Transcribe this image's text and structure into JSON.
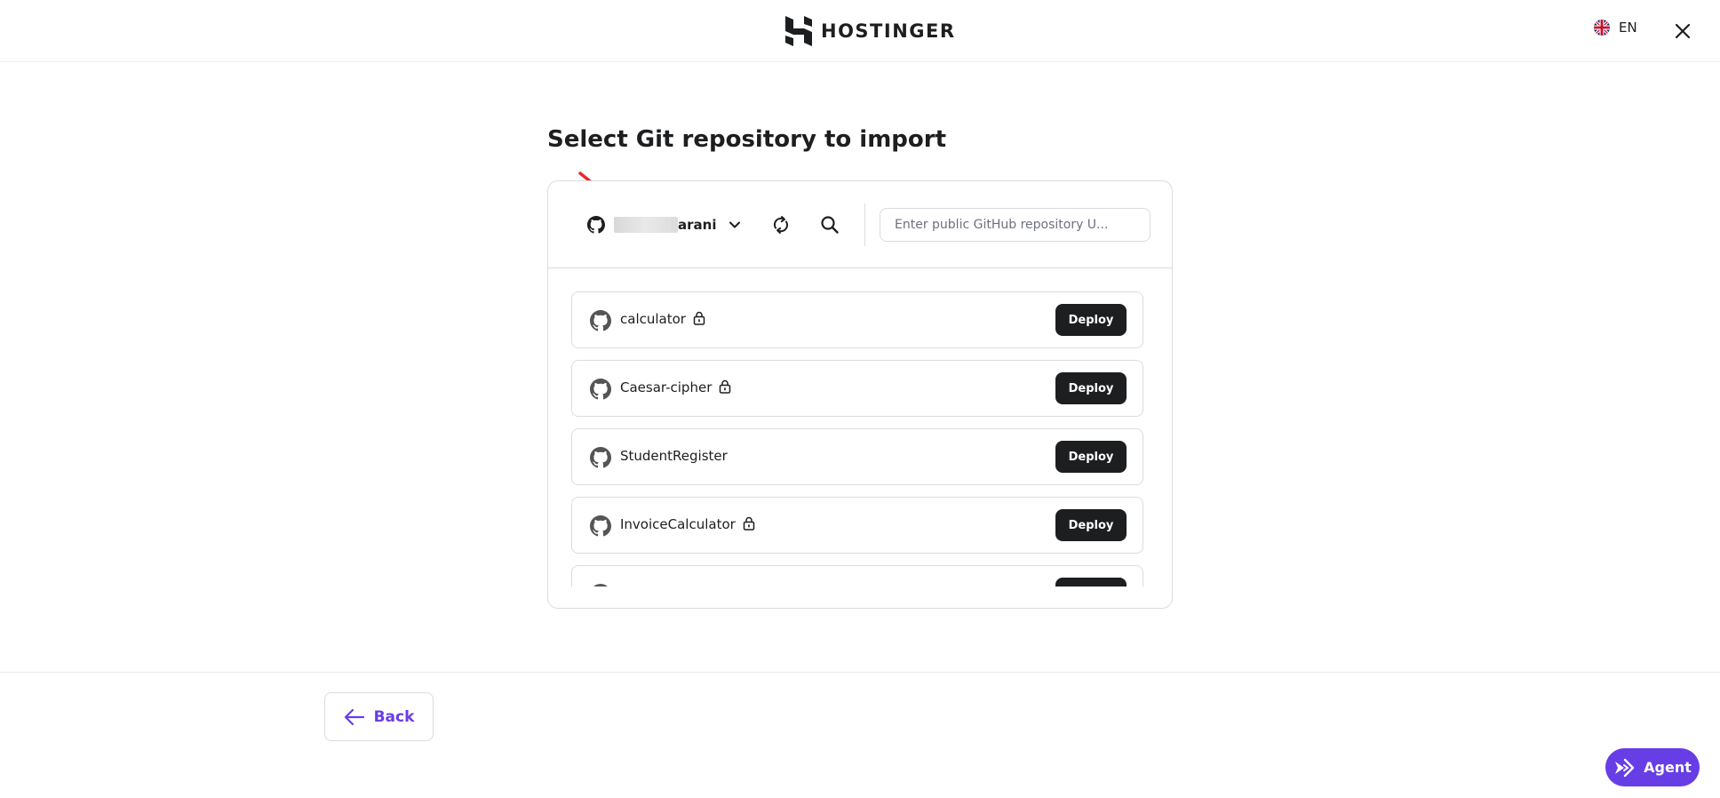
{
  "header": {
    "brand": "HOSTINGER",
    "language": "EN",
    "icons": {
      "logo": "hostinger-logo-icon",
      "flag": "uk-flag-icon",
      "close": "close-icon"
    }
  },
  "page": {
    "title": "Select Git repository to import"
  },
  "toolbar": {
    "account_name": "arani",
    "url_placeholder": "Enter public GitHub repository U...",
    "url_value": "",
    "icons": {
      "github": "github-icon",
      "dropdown": "chevron-down-icon",
      "refresh": "refresh-icon",
      "search": "search-icon"
    }
  },
  "repositories": [
    {
      "name": "calculator",
      "private": true,
      "action": "Deploy"
    },
    {
      "name": "Caesar-cipher",
      "private": true,
      "action": "Deploy"
    },
    {
      "name": "StudentRegister",
      "private": false,
      "action": "Deploy"
    },
    {
      "name": "InvoiceCalculator",
      "private": true,
      "action": "Deploy"
    }
  ],
  "footer": {
    "back_label": "Back",
    "agent_label": "Agent"
  },
  "colors": {
    "accent": "#673de6",
    "dark_button": "#1d1e20",
    "border": "#dadce0",
    "annotation": "#e8262b"
  }
}
